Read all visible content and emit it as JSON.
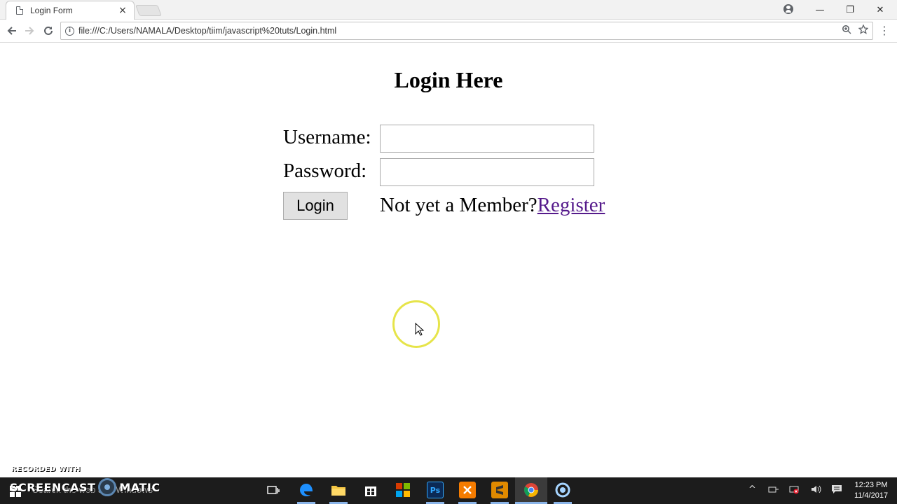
{
  "browser": {
    "tab_title": "Login Form",
    "tab_close": "×",
    "url": "file:///C:/Users/NAMALA/Desktop/tiim/javascript%20tuts/Login.html",
    "window_controls": {
      "minimize": "—",
      "restore": "❐",
      "close": "✕"
    }
  },
  "page": {
    "heading": "Login Here",
    "username_label": "Username:",
    "password_label": "Password:",
    "username_value": "",
    "password_value": "",
    "login_button": "Login",
    "member_text": "Not yet a Member?",
    "register_link": "Register",
    "register_link_color": "#551a8b"
  },
  "watermark": {
    "recorded_with": "RECORDED WITH",
    "brand_left": "SCREENCAST",
    "brand_right": "MATIC"
  },
  "taskbar": {
    "search_placeholder": "Search the web and Windows",
    "apps": [
      "task-view",
      "edge",
      "file-explorer",
      "store",
      "office",
      "photoshop",
      "xampp",
      "sublime-text",
      "chrome",
      "screencast-o-matic"
    ],
    "active_app": "chrome",
    "clock_time": "12:23 PM",
    "clock_date": "11/4/2017"
  }
}
